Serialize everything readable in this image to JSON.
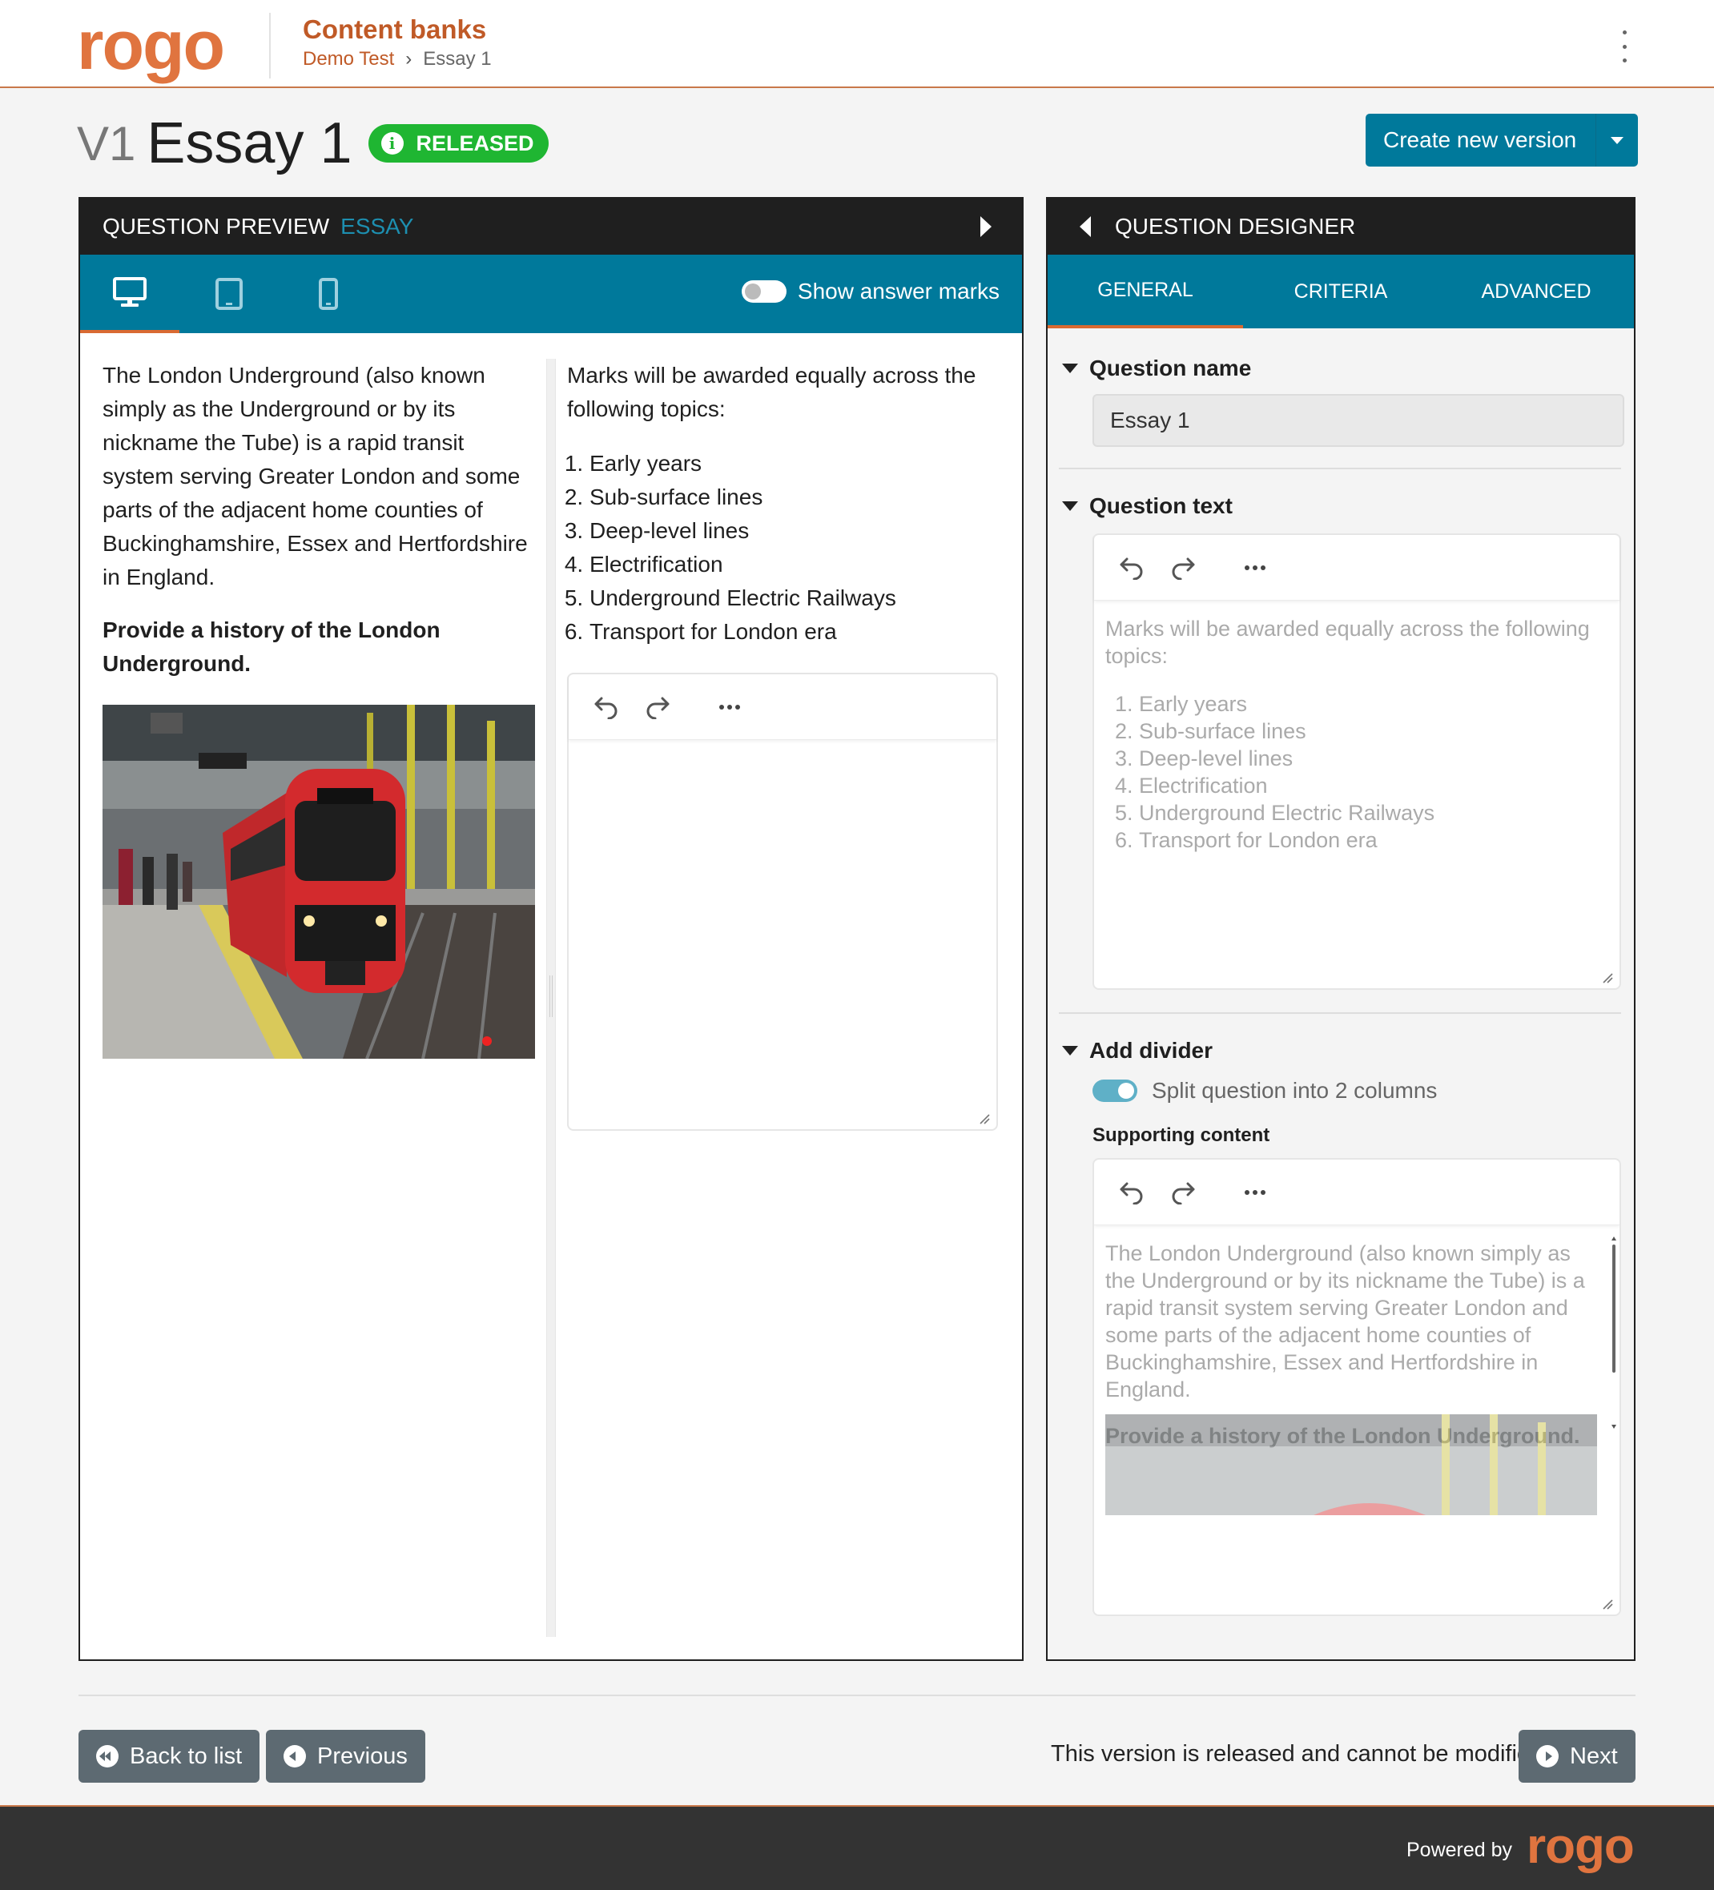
{
  "header": {
    "logo": "rogo",
    "app_title": "Content banks",
    "breadcrumb": [
      "Demo Test",
      "Essay 1"
    ]
  },
  "question": {
    "version": "V1",
    "title": "Essay 1",
    "status": "RELEASED",
    "create_version_label": "Create new version"
  },
  "preview": {
    "header": "QUESTION PREVIEW",
    "type": "ESSAY",
    "devices": [
      "desktop-icon",
      "tablet-icon",
      "mobile-icon"
    ],
    "show_marks_label": "Show answer marks",
    "supporting_text": "The London Underground (also known simply as the Underground or by its nickname the Tube) is a rapid transit system serving Greater London and some parts of the adjacent home counties of Buckinghamshire, Essex and Hertfordshire in England.",
    "prompt": "Provide a history of the London Underground.",
    "question_intro": "Marks will be awarded equally across the following topics:",
    "topics": [
      "Early years",
      "Sub-surface lines",
      "Deep-level lines",
      "Electrification",
      "Underground Electric Railways",
      "Transport for London era"
    ]
  },
  "designer": {
    "header": "QUESTION DESIGNER",
    "tabs": [
      "GENERAL",
      "CRITERIA",
      "ADVANCED"
    ],
    "question_name_label": "Question name",
    "question_name_value": "Essay 1",
    "question_text_label": "Question text",
    "add_divider_label": "Add divider",
    "split_label": "Split question into 2 columns",
    "supporting_content_label": "Supporting content"
  },
  "footer": {
    "back_label": "Back to list",
    "previous_label": "Previous",
    "status_text": "This version is released and cannot be modified",
    "next_label": "Next",
    "powered_by": "Powered by",
    "logo": "rogo"
  },
  "colors": {
    "brand_orange": "#e0743f",
    "teal": "#00799b",
    "released_green": "#1fb632",
    "dark": "#1f1f1f"
  }
}
